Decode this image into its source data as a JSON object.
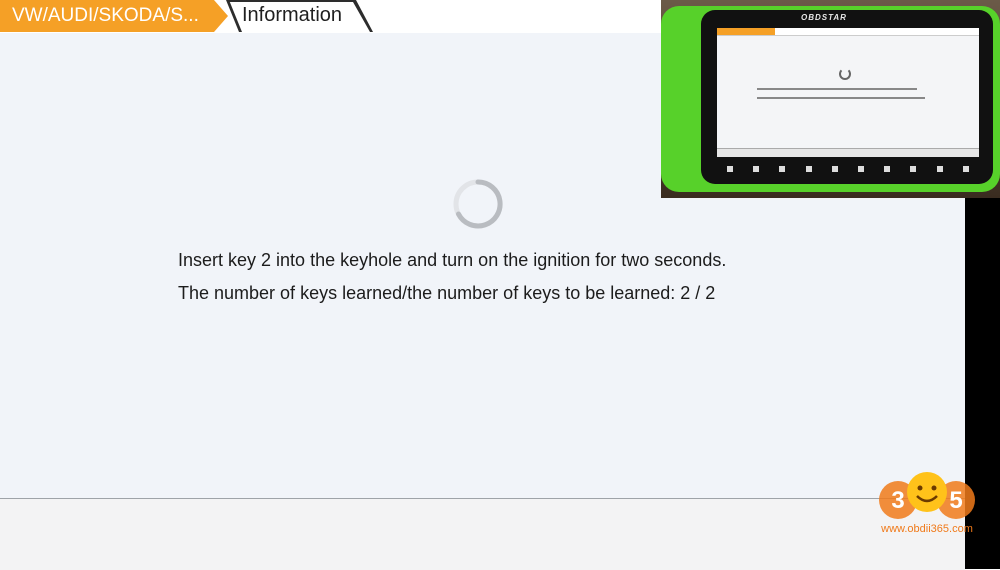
{
  "breadcrumb": {
    "home_label": "VW/AUDI/SKODA/S...",
    "current_label": "Information"
  },
  "main": {
    "message_line1": "Insert key 2 into the keyhole and turn on the ignition for two seconds.",
    "message_line2": "The number of keys learned/the number of keys to be learned: 2 / 2"
  },
  "overlay": {
    "device_brand": "OBDSTAR"
  },
  "watermark": {
    "logo_text": "365",
    "url": "www.obdii365.com"
  },
  "colors": {
    "accent": "#f5a026",
    "content_bg": "#f1f4f9",
    "text": "#1c1c1c",
    "device_green": "#57d12a",
    "logo_orange": "#f07a1a"
  },
  "icons": {
    "spinner": "loading-spinner-icon"
  }
}
